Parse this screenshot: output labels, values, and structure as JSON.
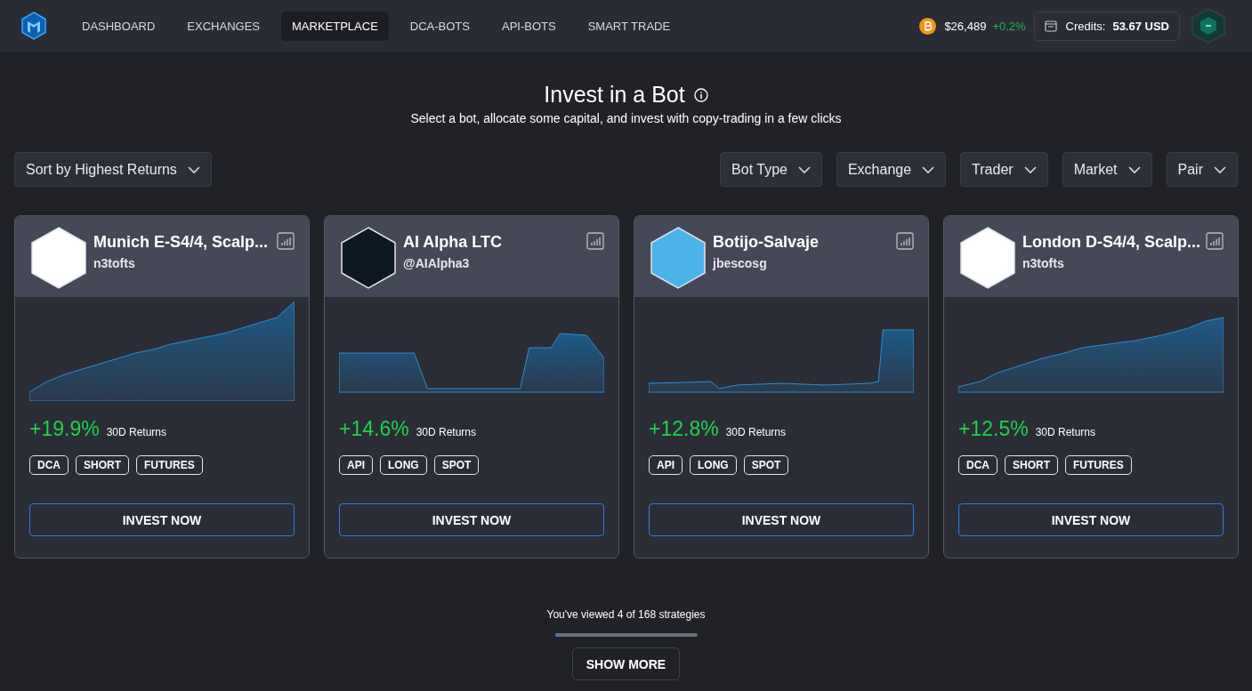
{
  "nav": {
    "items": [
      {
        "label": "DASHBOARD",
        "selected": false
      },
      {
        "label": "EXCHANGES",
        "selected": false
      },
      {
        "label": "MARKETPLACE",
        "selected": true
      },
      {
        "label": "DCA-BOTS",
        "selected": false
      },
      {
        "label": "API-BOTS",
        "selected": false
      },
      {
        "label": "SMART TRADE",
        "selected": false
      }
    ],
    "btc_price": "$26,489",
    "btc_change": "+0.2%",
    "credits_label": "Credits:",
    "credits_value": "53.67 USD"
  },
  "header": {
    "title": "Invest in a Bot",
    "subtitle": "Select a bot, allocate some capital, and invest with copy-trading in a few clicks"
  },
  "sort": {
    "label": "Sort by Highest Returns"
  },
  "filters": [
    "Bot Type",
    "Exchange",
    "Trader",
    "Market",
    "Pair"
  ],
  "bots": [
    {
      "name": "Munich E-S4/4, Scalp...",
      "author": "n3tofts",
      "returns": "+19.9%",
      "returns_label": "30D Returns",
      "tags": [
        "DCA",
        "SHORT",
        "FUTURES"
      ],
      "button": "INVEST NOW"
    },
    {
      "name": "AI Alpha LTC",
      "author": "@AIAlpha3",
      "returns": "+14.6%",
      "returns_label": "30D Returns",
      "tags": [
        "API",
        "LONG",
        "SPOT"
      ],
      "button": "INVEST NOW"
    },
    {
      "name": "Botijo-Salvaje",
      "author": "jbescosg",
      "returns": "+12.8%",
      "returns_label": "30D Returns",
      "tags": [
        "API",
        "LONG",
        "SPOT"
      ],
      "button": "INVEST NOW"
    },
    {
      "name": "London D-S4/4, Scalp...",
      "author": "n3tofts",
      "returns": "+12.5%",
      "returns_label": "30D Returns",
      "tags": [
        "DCA",
        "SHORT",
        "FUTURES"
      ],
      "button": "INVEST NOW"
    }
  ],
  "footer": {
    "viewed": "You've viewed 4 of 168 strategies",
    "level": 0.024,
    "button": "SHOW MORE"
  }
}
